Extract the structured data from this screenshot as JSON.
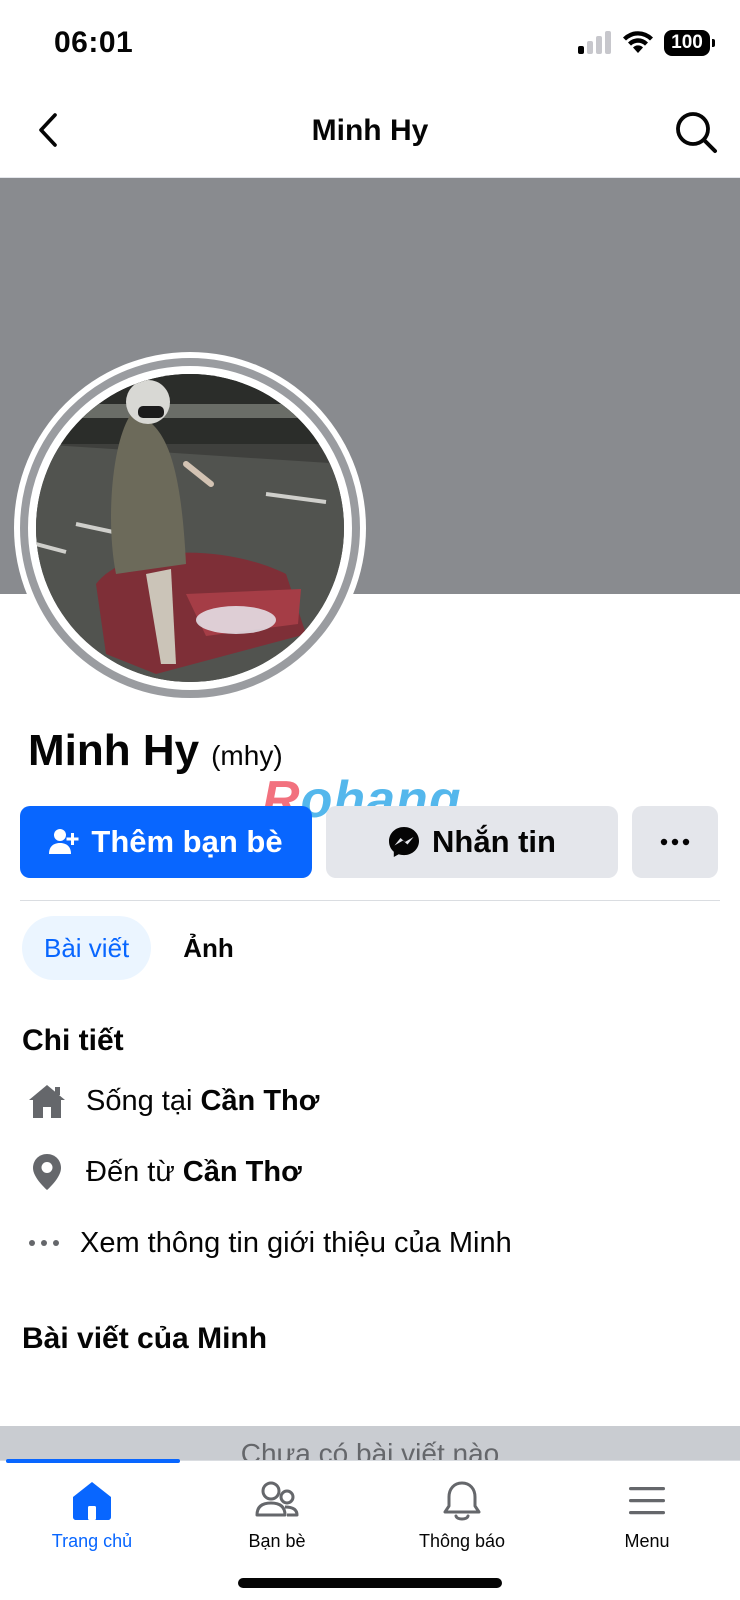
{
  "status_bar": {
    "time": "06:01",
    "battery": "100"
  },
  "nav": {
    "title": "Minh Hy"
  },
  "profile": {
    "name": "Minh Hy",
    "alias": "(mhy)"
  },
  "watermark": {
    "part1": "R",
    "part2": "ohang"
  },
  "actions": {
    "add_friend": "Thêm bạn bè",
    "message": "Nhắn tin",
    "more": "···"
  },
  "tabs": [
    {
      "label": "Bài viết",
      "active": true
    },
    {
      "label": "Ảnh",
      "active": false
    }
  ],
  "details": {
    "title": "Chi tiết",
    "lives_in_prefix": "Sống tại",
    "lives_in_place": "Cần Thơ",
    "from_prefix": "Đến từ",
    "from_place": "Cần Thơ",
    "see_intro": "Xem thông tin giới thiệu của Minh"
  },
  "posts": {
    "title": "Bài viết của Minh",
    "empty": "Chưa có bài viết nào"
  },
  "tabbar": {
    "home": "Trang chủ",
    "friends": "Bạn bè",
    "notifications": "Thông báo",
    "menu": "Menu"
  },
  "colors": {
    "accent": "#0866ff",
    "cover": "#898b8f",
    "button_gray": "#e4e6eb"
  }
}
